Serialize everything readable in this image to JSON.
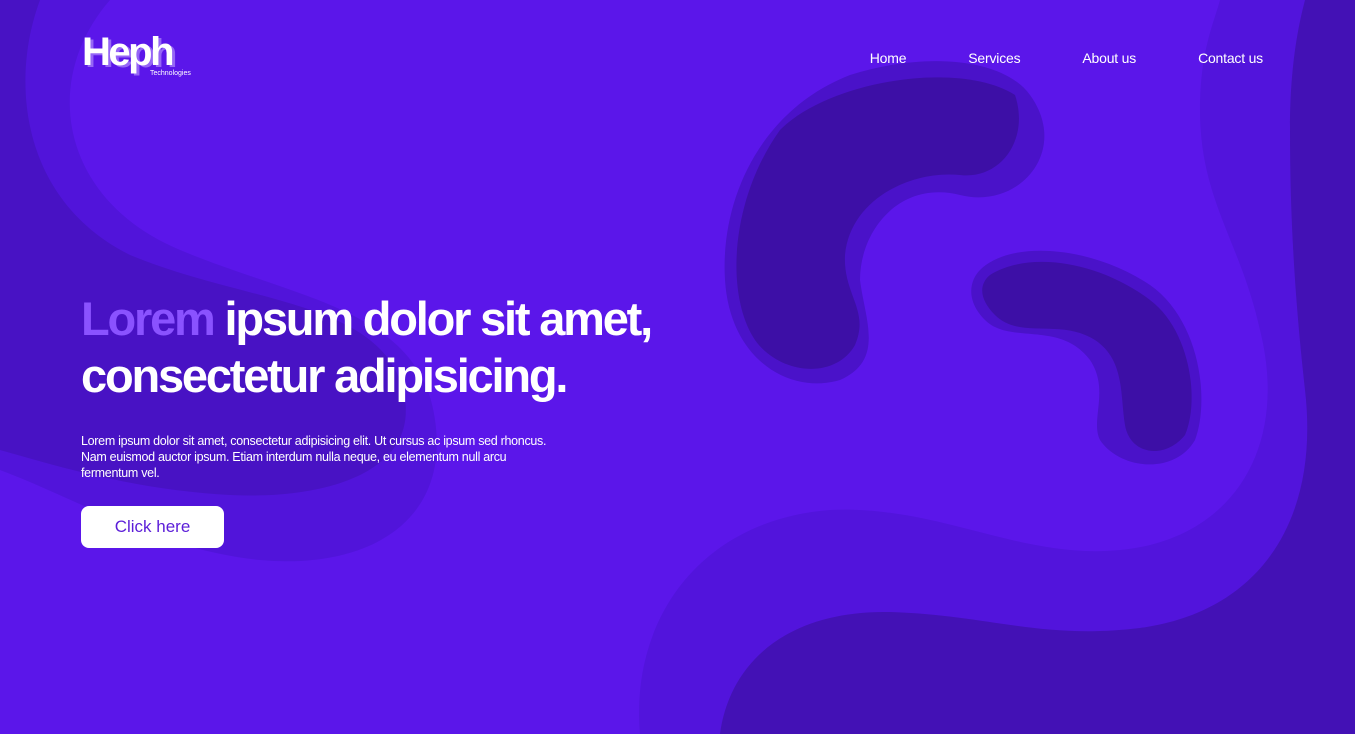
{
  "brand": {
    "logo_text": "Heph",
    "logo_subtitle": "Technologies"
  },
  "nav": {
    "items": [
      {
        "label": "Home"
      },
      {
        "label": "Services"
      },
      {
        "label": "About us"
      },
      {
        "label": "Contact us"
      }
    ]
  },
  "hero": {
    "title_accent": "Lorem",
    "title_rest": " ipsum dolor sit amet, consectetur adipisicing.",
    "text": "Lorem ipsum dolor sit amet, consectetur adipisicing elit. Ut cursus ac ipsum sed rhoncus. Nam euismod auctor ipsum. Etiam interdum nulla neque, eu elementum null arcu fermentum vel.",
    "cta_label": "Click here"
  },
  "colors": {
    "background": "#5b16ea",
    "accent_text": "#8a52ff",
    "button_text": "#5b1dd8"
  }
}
